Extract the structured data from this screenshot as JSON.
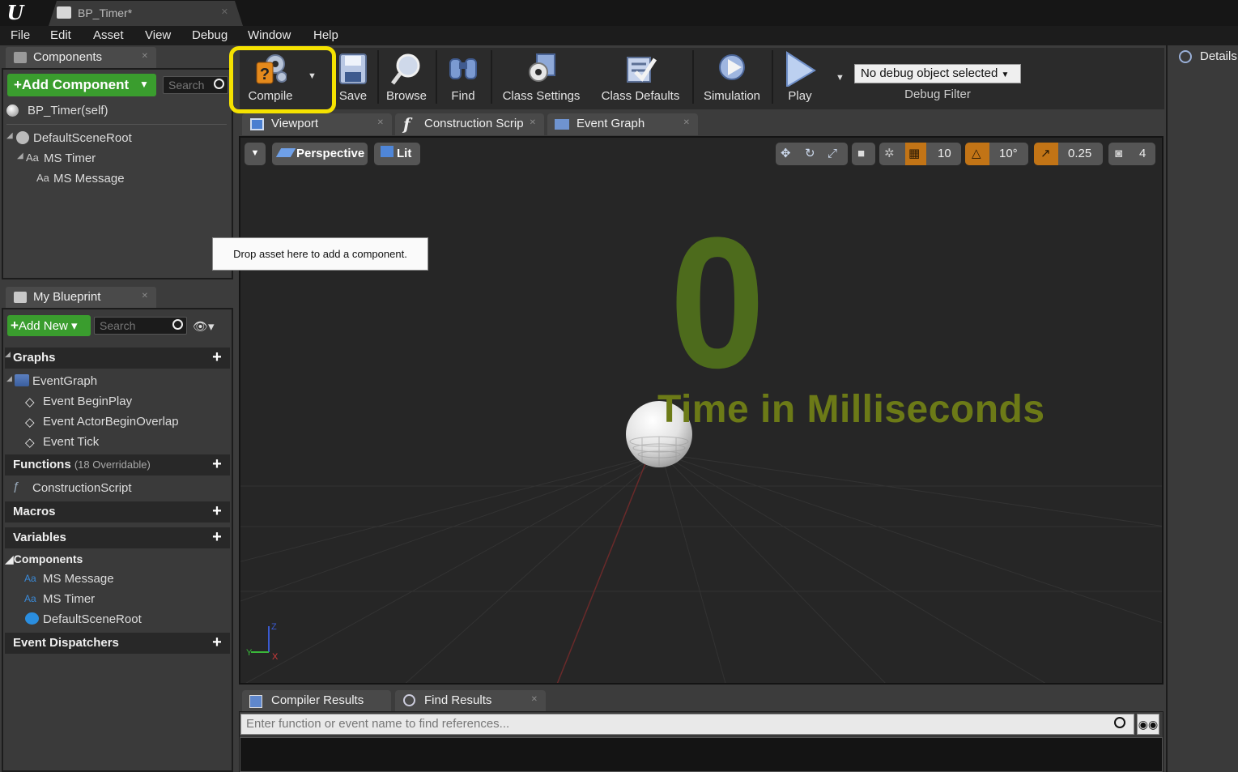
{
  "window": {
    "tab_title": "BP_Timer*",
    "logo": "U"
  },
  "menu": [
    "File",
    "Edit",
    "Asset",
    "View",
    "Debug",
    "Window",
    "Help"
  ],
  "components_panel": {
    "tab_label": "Components",
    "add_button": "+Add Component",
    "search_placeholder": "Search",
    "self_item": "BP_Timer(self)",
    "tree": [
      "DefaultSceneRoot",
      "MS Timer",
      "MS Message"
    ]
  },
  "toolbar": {
    "compile": "Compile",
    "save": "Save",
    "browse": "Browse",
    "find": "Find",
    "class_settings": "Class Settings",
    "class_defaults": "Class Defaults",
    "simulation": "Simulation",
    "play": "Play",
    "debug_object": "No debug object selected",
    "debug_filter": "Debug Filter"
  },
  "editor_tabs": [
    "Viewport",
    "Construction Scrip",
    "Event Graph"
  ],
  "viewport": {
    "perspective": "Perspective",
    "lit": "Lit",
    "grid_snap": "10",
    "rotation_snap": "10°",
    "scale_snap": "0.25",
    "camera_speed": "4",
    "tooltip": "Drop asset here to add a component.",
    "big_number": "0",
    "caption": "Time in Milliseconds"
  },
  "my_blueprint": {
    "tab_label": "My Blueprint",
    "add_new": "Add New",
    "search_placeholder": "Search",
    "graphs_label": "Graphs",
    "event_graph": "EventGraph",
    "events": [
      "Event BeginPlay",
      "Event ActorBeginOverlap",
      "Event Tick"
    ],
    "functions_label": "Functions",
    "functions_sub": "(18 Overridable)",
    "construction_script": "ConstructionScript",
    "macros_label": "Macros",
    "variables_label": "Variables",
    "components_label": "Components",
    "component_vars": [
      "MS Message",
      "MS Timer",
      "DefaultSceneRoot"
    ],
    "event_dispatchers_label": "Event Dispatchers"
  },
  "bottom": {
    "tabs": [
      "Compiler Results",
      "Find Results"
    ],
    "find_placeholder": "Enter function or event name to find references..."
  },
  "details": {
    "tab_label": "Details"
  },
  "colors": {
    "compile_highlight": "#f5e200",
    "add_green": "#3a9d2e",
    "timer_green": "#4d6b1c"
  }
}
